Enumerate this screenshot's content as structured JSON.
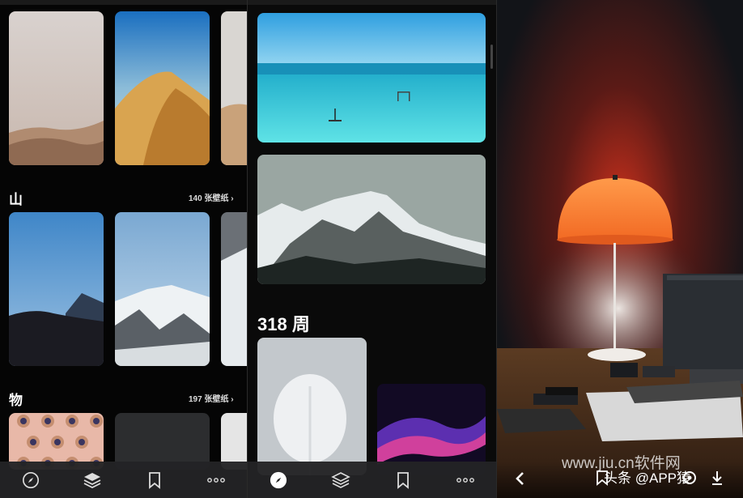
{
  "panel_left": {
    "sections": [
      {
        "title": "山",
        "count": "140 张壁纸 ›"
      },
      {
        "title": "物",
        "count": "197 张壁纸 ›"
      }
    ],
    "tabbar": [
      "compass-icon",
      "layers-icon",
      "bookmark-icon",
      "more-icon"
    ]
  },
  "panel_middle": {
    "week_title": "318 周",
    "tabbar": [
      "compass-icon",
      "layers-icon",
      "bookmark-icon",
      "more-icon"
    ]
  },
  "panel_right": {
    "watermark_site": "www.jiu.cn软件网",
    "watermark_author": "头条 @APP猿",
    "nav": [
      "back-icon",
      "bookmark-icon",
      "settings-icon",
      "download-icon"
    ]
  },
  "colors": {
    "accent": "#ffffff",
    "tabbar_bg": "#232325"
  }
}
